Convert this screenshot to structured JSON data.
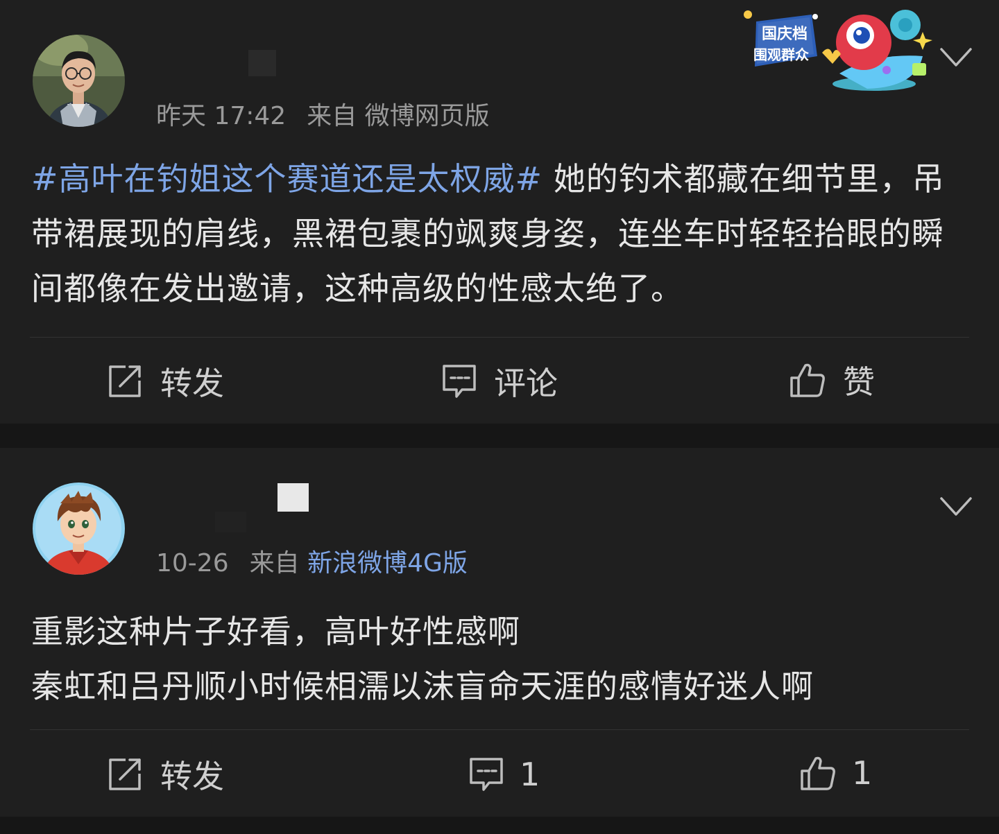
{
  "colors": {
    "background": "#161616",
    "card": "#1f1f1f",
    "link": "#7ea5e6",
    "text": "#e6e6e6",
    "meta": "#9a9a9a",
    "icon": "#bdbdbd"
  },
  "posts": [
    {
      "time": "昨天 17:42",
      "source_prefix": "来自",
      "source": "微博网页版",
      "badge": {
        "line1": "国庆档",
        "line2": "围观群众"
      },
      "hashtag": "#高叶在钓姐这个赛道还是太权威#",
      "body": " 她的钓术都藏在细节里，吊带裙展现的肩线，黑裙包裹的飒爽身姿，连坐车时轻轻抬眼的瞬间都像在发出邀请，这种高级的性感太绝了。",
      "actions": {
        "repost": "转发",
        "comment": "评论",
        "like": "赞"
      }
    },
    {
      "time": "10-26",
      "source_prefix": "来自",
      "source": "新浪微博4G版",
      "body_lines": [
        "重影这种片子好看，高叶好性感啊",
        "秦虹和吕丹顺小时候相濡以沫盲命天涯的感情好迷人啊"
      ],
      "actions": {
        "repost": "转发",
        "comment_count": "1",
        "like_count": "1"
      }
    }
  ]
}
